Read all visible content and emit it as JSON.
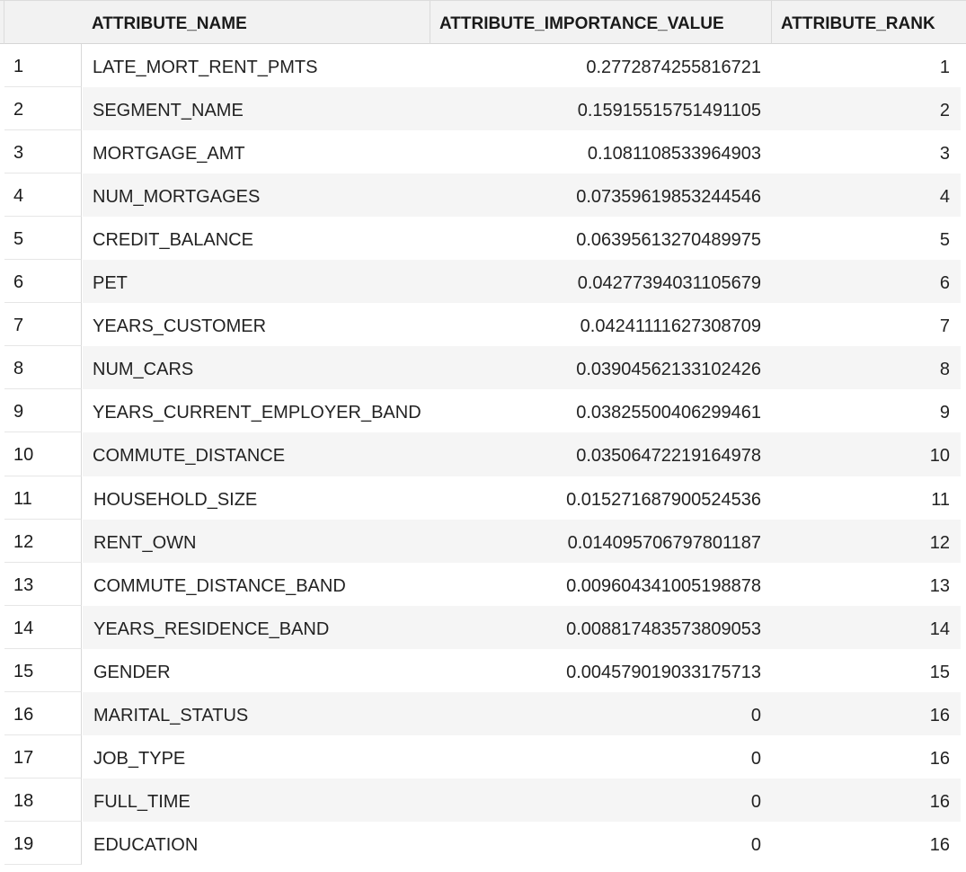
{
  "columns": {
    "index": "",
    "name": "ATTRIBUTE_NAME",
    "value": "ATTRIBUTE_IMPORTANCE_VALUE",
    "rank": "ATTRIBUTE_RANK"
  },
  "rows": [
    {
      "idx": "1",
      "name": "LATE_MORT_RENT_PMTS",
      "value": "0.2772874255816721",
      "rank": "1"
    },
    {
      "idx": "2",
      "name": "SEGMENT_NAME",
      "value": "0.15915515751491105",
      "rank": "2"
    },
    {
      "idx": "3",
      "name": "MORTGAGE_AMT",
      "value": "0.1081108533964903",
      "rank": "3"
    },
    {
      "idx": "4",
      "name": "NUM_MORTGAGES",
      "value": "0.07359619853244546",
      "rank": "4"
    },
    {
      "idx": "5",
      "name": "CREDIT_BALANCE",
      "value": "0.06395613270489975",
      "rank": "5"
    },
    {
      "idx": "6",
      "name": "PET",
      "value": "0.04277394031105679",
      "rank": "6"
    },
    {
      "idx": "7",
      "name": "YEARS_CUSTOMER",
      "value": "0.04241111627308709",
      "rank": "7"
    },
    {
      "idx": "8",
      "name": "NUM_CARS",
      "value": "0.03904562133102426",
      "rank": "8"
    },
    {
      "idx": "9",
      "name": "YEARS_CURRENT_EMPLOYER_BAND",
      "value": "0.03825500406299461",
      "rank": "9"
    },
    {
      "idx": "10",
      "name": "COMMUTE_DISTANCE",
      "value": "0.03506472219164978",
      "rank": "10"
    },
    {
      "idx": "11",
      "name": "HOUSEHOLD_SIZE",
      "value": "0.015271687900524536",
      "rank": "11"
    },
    {
      "idx": "12",
      "name": "RENT_OWN",
      "value": "0.014095706797801187",
      "rank": "12"
    },
    {
      "idx": "13",
      "name": "COMMUTE_DISTANCE_BAND",
      "value": "0.009604341005198878",
      "rank": "13"
    },
    {
      "idx": "14",
      "name": "YEARS_RESIDENCE_BAND",
      "value": "0.008817483573809053",
      "rank": "14"
    },
    {
      "idx": "15",
      "name": "GENDER",
      "value": "0.004579019033175713",
      "rank": "15"
    },
    {
      "idx": "16",
      "name": "MARITAL_STATUS",
      "value": "0",
      "rank": "16"
    },
    {
      "idx": "17",
      "name": "JOB_TYPE",
      "value": "0",
      "rank": "16"
    },
    {
      "idx": "18",
      "name": "FULL_TIME",
      "value": "0",
      "rank": "16"
    },
    {
      "idx": "19",
      "name": "EDUCATION",
      "value": "0",
      "rank": "16"
    }
  ]
}
